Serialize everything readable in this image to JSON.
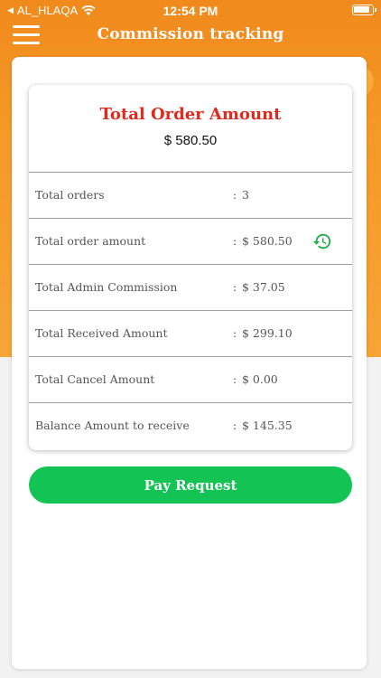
{
  "status_bar": {
    "carrier": "AL_HLAQA",
    "time": "12:54 PM"
  },
  "header": {
    "title": "Commission tracking"
  },
  "summary": {
    "title": "Total Order Amount",
    "total": "$ 580.50"
  },
  "details": [
    {
      "label": "Total orders",
      "colon": ":",
      "value": "3"
    },
    {
      "label": "Total order amount",
      "colon": ":",
      "value": "$ 580.50"
    },
    {
      "label": "Total Admin Commission",
      "colon": ":",
      "value": "$ 37.05"
    },
    {
      "label": "Total Received Amount",
      "colon": ":",
      "value": "$ 299.10"
    },
    {
      "label": "Total Cancel Amount",
      "colon": ":",
      "value": "$ 0.00"
    },
    {
      "label": "Balance Amount to receive",
      "colon": ":",
      "value": "$ 145.35"
    }
  ],
  "actions": {
    "pay_request_label": "Pay Request"
  },
  "colors": {
    "accent_orange": "#f59a28",
    "title_red": "#e12a1e",
    "button_green": "#13c455"
  },
  "icons": {
    "history": "history-icon",
    "menu": "hamburger-menu-icon"
  }
}
